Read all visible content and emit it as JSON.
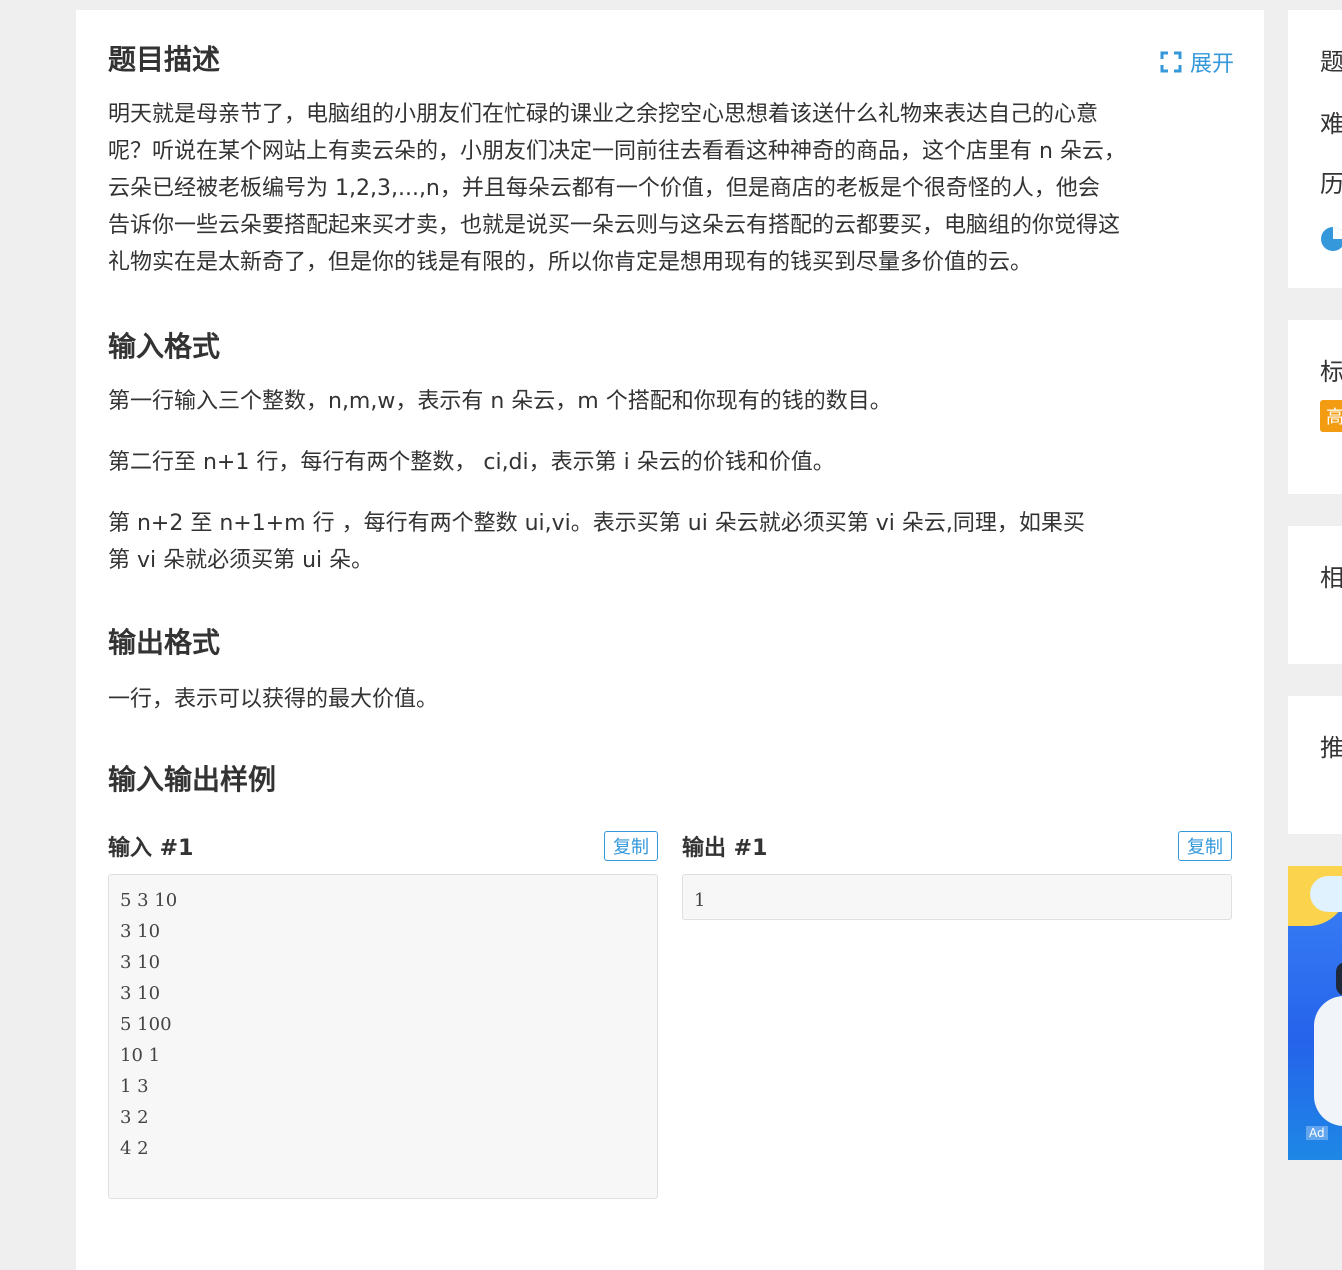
{
  "problem": {
    "expand_label": "展开",
    "description_title": "题目描述",
    "description_lines": [
      "明天就是母亲节了，电脑组的小朋友们在忙碌的课业之余挖空心思想着该送什么礼物来表达自己的心意",
      "呢？听说在某个网站上有卖云朵的，小朋友们决定一同前往去看看这种神奇的商品，这个店里有 n 朵云，",
      "云朵已经被老板编号为 1,2,3,...,n，并且每朵云都有一个价值，但是商店的老板是个很奇怪的人，他会",
      "告诉你一些云朵要搭配起来买才卖，也就是说买一朵云则与这朵云有搭配的云都要买，电脑组的你觉得这",
      "礼物实在是太新奇了，但是你的钱是有限的，所以你肯定是想用现有的钱买到尽量多价值的云。"
    ],
    "input_title": "输入格式",
    "input_line1": "第一行输入三个整数，n,m,w，表示有 n 朵云，m 个搭配和你现有的钱的数目。",
    "input_line2": "第二行至 n+1 行，每行有两个整数， ci,di，表示第 i 朵云的价钱和价值。",
    "input_line3a": "第 n+2 至 n+1+m 行 ，每行有两个整数 ui,vi。表示买第 ui 朵云就必须买第 vi 朵云,同理，如果买",
    "input_line3b": "第 vi 朵就必须买第 ui 朵。",
    "output_title": "输出格式",
    "output_text": "一行，表示可以获得的最大价值。",
    "samples_title": "输入输出样例",
    "input_sample_label": "输入 #1",
    "output_sample_label": "输出 #1",
    "copy_label": "复制",
    "input_sample_lines": [
      "5 3 10",
      "3 10",
      "3 10",
      "3 10",
      "5 100",
      "10 1",
      "1 3",
      "3 2",
      "4 2"
    ],
    "output_sample_lines": [
      "1"
    ]
  },
  "sidebar": {
    "card1": [
      "题",
      "难",
      "历"
    ],
    "card2": "标",
    "card2_badge": "高",
    "card3": "相",
    "card4": "推",
    "ad_label": "Ad",
    "accent": "#3498db",
    "badge_color": "#f39c12"
  }
}
